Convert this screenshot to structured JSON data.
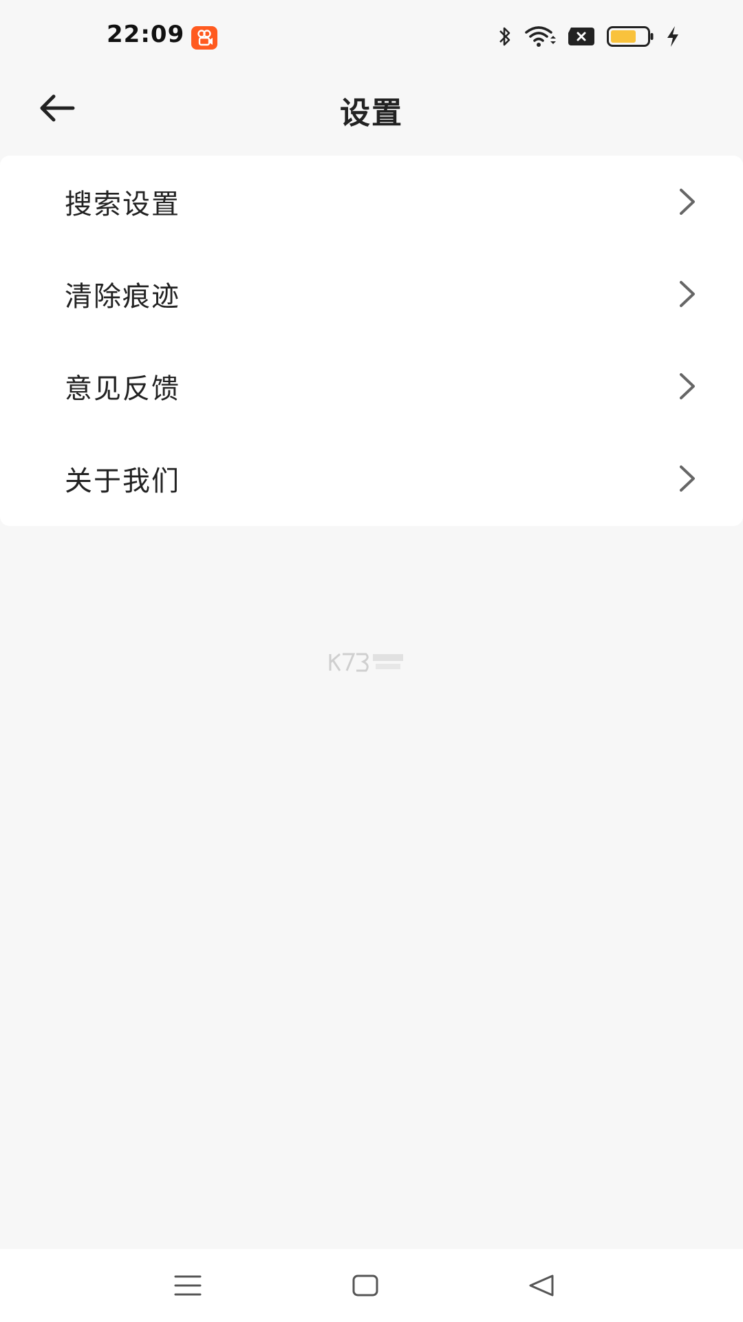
{
  "status_bar": {
    "time": "22:09",
    "app_icon": "kuaishou-app-icon",
    "icons": [
      "bluetooth-icon",
      "wifi-icon",
      "sim-disabled-icon",
      "battery-icon",
      "charging-icon"
    ],
    "battery_color": "#f9c23c"
  },
  "header": {
    "title": "设置",
    "back_icon": "arrow-left-icon"
  },
  "settings": {
    "items": [
      {
        "label": "搜索设置"
      },
      {
        "label": "清除痕迹"
      },
      {
        "label": "意见反馈"
      },
      {
        "label": "关于我们"
      }
    ]
  },
  "navigation": {
    "buttons": [
      "menu-icon",
      "home-icon",
      "back-triangle-icon"
    ]
  },
  "colors": {
    "background": "#f7f7f7",
    "card": "#ffffff",
    "accent": "#ff5a1f"
  }
}
